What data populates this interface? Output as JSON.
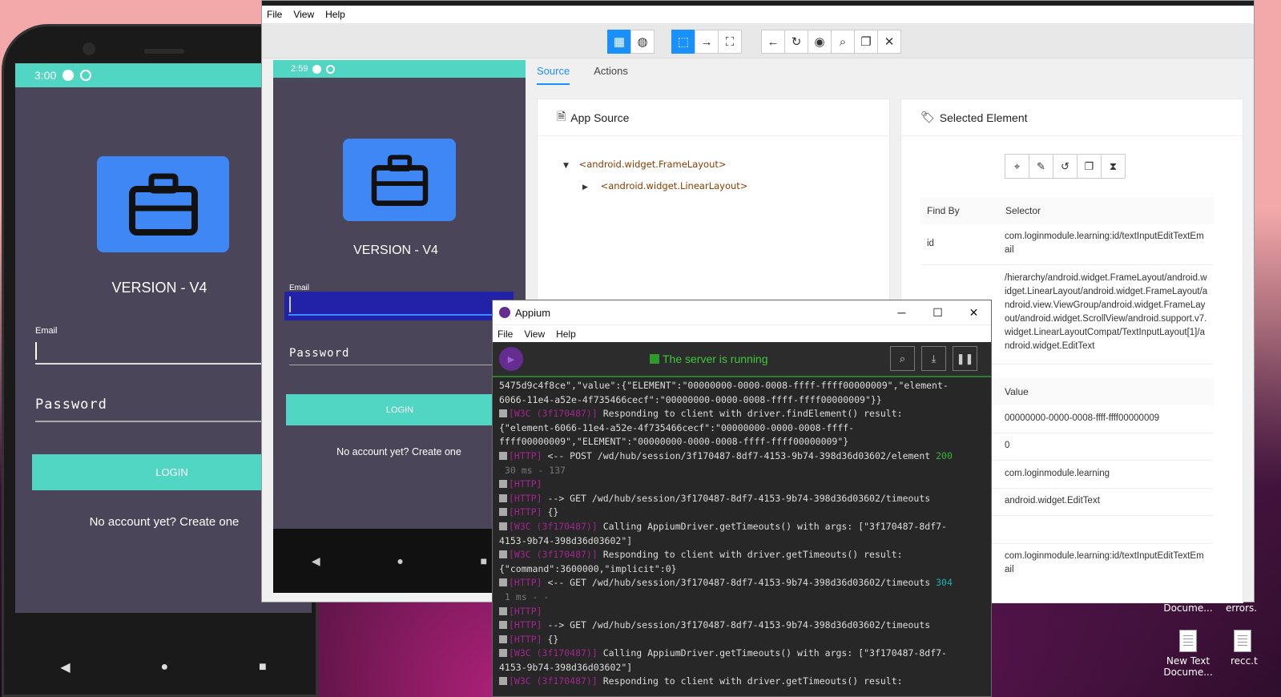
{
  "desktop": {
    "icons": [
      {
        "label": "Docume..."
      },
      {
        "label": "errors."
      },
      {
        "label": "New Text Docume..."
      },
      {
        "label": "recc.t"
      }
    ]
  },
  "emulator": {
    "status_time": "3:00",
    "version": "VERSION - V4",
    "email_label": "Email",
    "password_placeholder": "Password",
    "login_label": "LOGIN",
    "no_account": "No account yet? Create one",
    "accent_color": "#52d6c4",
    "logo_color": "#3f87f5"
  },
  "inspector": {
    "menu": [
      "File",
      "View",
      "Help"
    ],
    "device": {
      "status_time": "2:59",
      "version": "VERSION - V4",
      "email_label": "Email",
      "password_placeholder": "Password",
      "login_label": "LOGIN",
      "no_account": "No account yet? Create one"
    },
    "tabs": [
      "Source",
      "Actions"
    ],
    "app_source": {
      "title": "App Source",
      "nodes": [
        "<android.widget.FrameLayout>",
        "<android.widget.LinearLayout>"
      ]
    },
    "selected": {
      "title": "Selected Element",
      "find_by_header": "Find By",
      "selector_header": "Selector",
      "rows": [
        {
          "find_by": "id",
          "selector": "com.loginmodule.learning:id/textInputEditTextEmail"
        },
        {
          "find_by": "",
          "selector": "/hierarchy/android.widget.FrameLayout/android.widget.LinearLayout/android.widget.FrameLayout/android.view.ViewGroup/android.widget.FrameLayout/android.widget.ScrollView/android.support.v7.widget.LinearLayoutCompat/TextInputLayout[1]/android.widget.EditText"
        }
      ],
      "value_header": "Value",
      "values": [
        "00000000-0000-0008-ffff-ffff00000009",
        "0",
        "com.loginmodule.learning",
        "android.widget.EditText",
        "",
        "com.loginmodule.learning:id/textInputEditTextEmail"
      ]
    }
  },
  "server": {
    "title": "Appium",
    "menu": [
      "File",
      "View",
      "Help"
    ],
    "status": "The server is running",
    "log": [
      {
        "tag": "",
        "text": "5475d9c4f8ce\",\"value\":{\"ELEMENT\":\"00000000-0000-0008-ffff-ffff00000009\",\"element-",
        "extra": ""
      },
      {
        "tag": "",
        "text": "6066-11e4-a52e-4f735466cecf\":\"00000000-0000-0008-ffff-ffff00000009\"}}",
        "extra": ""
      },
      {
        "tag": "[W3C (3f170487)]",
        "text": " Responding to client with driver.findElement() result:",
        "extra": ""
      },
      {
        "tag": "",
        "text": "{\"element-6066-11e4-a52e-4f735466cecf\":\"00000000-0000-0008-ffff-",
        "extra": ""
      },
      {
        "tag": "",
        "text": "ffff00000009\",\"ELEMENT\":\"00000000-0000-0008-ffff-ffff00000009\"}",
        "extra": ""
      },
      {
        "tag": "[HTTP]",
        "text": " <-- POST /wd/hub/session/3f170487-8df7-4153-9b74-398d36d03602/element ",
        "extra": "200"
      },
      {
        "tag": "",
        "text": " 30 ms - 137",
        "extra": ""
      },
      {
        "tag": "[HTTP]",
        "text": "",
        "extra": ""
      },
      {
        "tag": "[HTTP]",
        "text": " --> GET /wd/hub/session/3f170487-8df7-4153-9b74-398d36d03602/timeouts",
        "extra": ""
      },
      {
        "tag": "[HTTP]",
        "text": " {}",
        "extra": ""
      },
      {
        "tag": "[W3C (3f170487)]",
        "text": " Calling AppiumDriver.getTimeouts() with args: [\"3f170487-8df7-",
        "extra": ""
      },
      {
        "tag": "",
        "text": "4153-9b74-398d36d03602\"]",
        "extra": ""
      },
      {
        "tag": "[W3C (3f170487)]",
        "text": " Responding to client with driver.getTimeouts() result:",
        "extra": ""
      },
      {
        "tag": "",
        "text": "{\"command\":3600000,\"implicit\":0}",
        "extra": ""
      },
      {
        "tag": "[HTTP]",
        "text": " <-- GET /wd/hub/session/3f170487-8df7-4153-9b74-398d36d03602/timeouts ",
        "extra": "304"
      },
      {
        "tag": "",
        "text": " 1 ms - -",
        "extra": ""
      },
      {
        "tag": "[HTTP]",
        "text": "",
        "extra": ""
      },
      {
        "tag": "[HTTP]",
        "text": " --> GET /wd/hub/session/3f170487-8df7-4153-9b74-398d36d03602/timeouts",
        "extra": ""
      },
      {
        "tag": "[HTTP]",
        "text": " {}",
        "extra": ""
      },
      {
        "tag": "[W3C (3f170487)]",
        "text": " Calling AppiumDriver.getTimeouts() with args: [\"3f170487-8df7-",
        "extra": ""
      },
      {
        "tag": "",
        "text": "4153-9b74-398d36d03602\"]",
        "extra": ""
      },
      {
        "tag": "[W3C (3f170487)]",
        "text": " Responding to client with driver.getTimeouts() result:",
        "extra": ""
      }
    ]
  }
}
